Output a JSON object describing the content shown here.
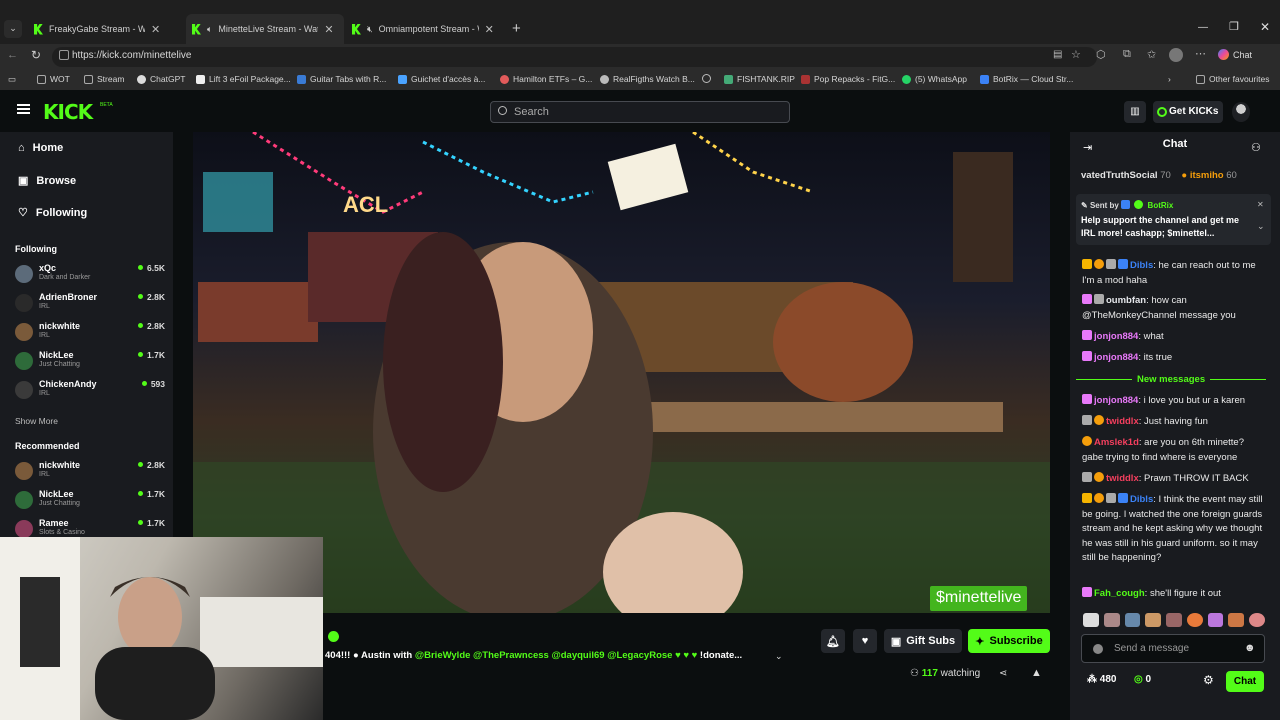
{
  "browser": {
    "tabs": [
      {
        "title": "FreakyGabe Stream - Watch L"
      },
      {
        "title": "MinetteLive Stream - Watch L"
      },
      {
        "title": "Omniampotent Stream - Wat"
      }
    ],
    "url": "https://kick.com/minettelive",
    "chat_label": "Chat",
    "bookmarks": [
      "WOT",
      "Stream",
      "ChatGPT",
      "Lift 3 eFoil Package...",
      "Guitar Tabs with R...",
      "Guichet d'accès à...",
      "Hamilton ETFs – G...",
      "RealFigths Watch B...",
      "FISHTANK.RIP",
      "Pop Repacks - FitG...",
      "(5) WhatsApp",
      "BotRix — Cloud Str..."
    ],
    "other_favourites": "Other favourites"
  },
  "kick": {
    "logo": "KICK",
    "beta": "BETA",
    "search_placeholder": "Search",
    "get_kicks": "Get KICKs"
  },
  "sidebar": {
    "nav": [
      "Home",
      "Browse",
      "Following"
    ],
    "following_title": "Following",
    "following": [
      {
        "name": "xQc",
        "category": "Dark and Darker",
        "viewers": "6.5K"
      },
      {
        "name": "AdrienBroner",
        "category": "IRL",
        "viewers": "2.8K"
      },
      {
        "name": "nickwhite",
        "category": "IRL",
        "viewers": "2.8K"
      },
      {
        "name": "NickLee",
        "category": "Just Chatting",
        "viewers": "1.7K"
      },
      {
        "name": "ChickenAndy",
        "category": "IRL",
        "viewers": "593"
      }
    ],
    "show_more": "Show More",
    "recommended_title": "Recommended",
    "recommended": [
      {
        "name": "nickwhite",
        "category": "IRL",
        "viewers": "2.8K"
      },
      {
        "name": "NickLee",
        "category": "Just Chatting",
        "viewers": "1.7K"
      },
      {
        "name": "Ramee",
        "category": "Slots & Casino",
        "viewers": "1.7K"
      }
    ]
  },
  "video": {
    "overlay_tag": "$minettelive"
  },
  "stream": {
    "ticker_plain1": "404!!! ",
    "ticker_plain2": " Austin with ",
    "ticker_mentions": "@BrieWylde @ThePrawncess @dayquil69 @LegacyRose",
    "ticker_tail": " !donate...",
    "gift_subs": "Gift Subs",
    "subscribe": "Subscribe",
    "watching_count": "117",
    "watching_label": "watching"
  },
  "chat": {
    "title": "Chat",
    "top_line_user1": "vatedTruthSocial",
    "top_line_val1": "70",
    "top_line_user2": "itsmiho",
    "top_line_val2": "60",
    "pinned_sent_by": "Sent by",
    "pinned_sender": "BotRix",
    "pinned_text": "Help support the channel and get me IRL more! cashapp; $minettel...",
    "messages": [
      {
        "user": "Dibls",
        "color": "#3b82f6",
        "text": "he can reach out to me I'm a mod haha"
      },
      {
        "user": "oumbfan",
        "color": "#e5e7eb",
        "text": "how can @TheMonkeyChannel message you"
      },
      {
        "user": "jonjon884",
        "color": "#e879f9",
        "text": "what"
      },
      {
        "user": "jonjon884",
        "color": "#e879f9",
        "text": "its true"
      },
      {
        "user": "jonjon884",
        "color": "#e879f9",
        "text": "i love you but ur a karen"
      },
      {
        "user": "twiddlx",
        "color": "#f43f5e",
        "text": "Just having fun"
      },
      {
        "user": "Amslek1d",
        "color": "#f43f5e",
        "text": "are you on 6th minette? gabe trying to find where is everyone"
      },
      {
        "user": "twiddlx",
        "color": "#f43f5e",
        "text": "Prawn THROW IT BACK"
      },
      {
        "user": "Dibls",
        "color": "#3b82f6",
        "text": "I think the event may still be going. I watched the one foreign guards stream and he kept asking why we thought he was still in his guard uniform. so it may still be happening?"
      },
      {
        "user": "Fah_cough",
        "color": "#53fc18",
        "text": "she'll figure it out"
      }
    ],
    "new_messages": "New messages",
    "send_placeholder": "Send a message",
    "points": "480",
    "kicks": "0",
    "chat_button": "Chat",
    "accent": "#53fc18"
  }
}
